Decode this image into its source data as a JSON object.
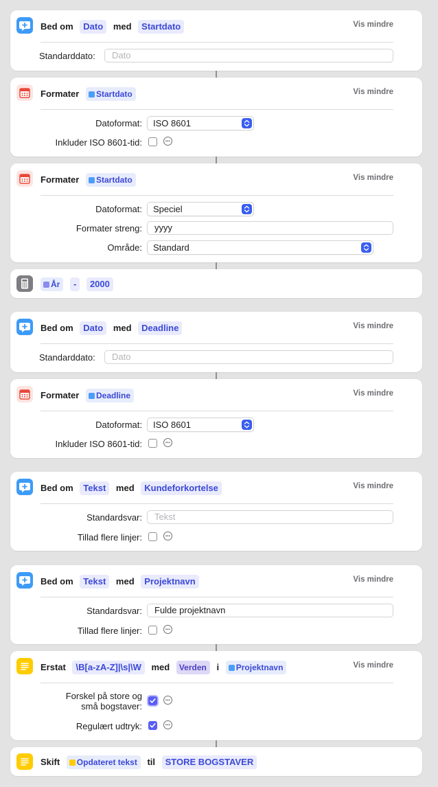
{
  "common": {
    "vis_mindre": "Vis mindre"
  },
  "blocks": {
    "ask_startdato": {
      "verb": "Bed om",
      "type_token": "Dato",
      "med": "med",
      "name_token": "Startdato",
      "default_label": "Standarddato:",
      "default_placeholder": "Dato"
    },
    "format1": {
      "verb": "Formater",
      "input_token": "Startdato",
      "format_label": "Datoformat:",
      "format_value": "ISO 8601",
      "iso_time_label": "Inkluder ISO 8601-tid:"
    },
    "format2": {
      "verb": "Formater",
      "input_token": "Startdato",
      "format_label": "Datoformat:",
      "format_value": "Speciel",
      "string_label": "Formater streng:",
      "string_value": "yyyy",
      "region_label": "Område:",
      "region_value": "Standard"
    },
    "calc": {
      "operand1": "År",
      "operator": "-",
      "operand2": "2000"
    },
    "ask_deadline": {
      "verb": "Bed om",
      "type_token": "Dato",
      "med": "med",
      "name_token": "Deadline",
      "default_label": "Standarddato:",
      "default_placeholder": "Dato"
    },
    "format3": {
      "verb": "Formater",
      "input_token": "Deadline",
      "format_label": "Datoformat:",
      "format_value": "ISO 8601",
      "iso_time_label": "Inkluder ISO 8601-tid:"
    },
    "ask_kunde": {
      "verb": "Bed om",
      "type_token": "Tekst",
      "med": "med",
      "name_token": "Kundeforkortelse",
      "answer_label": "Standardsvar:",
      "answer_placeholder": "Tekst",
      "multiline_label": "Tillad flere linjer:"
    },
    "ask_projekt": {
      "verb": "Bed om",
      "type_token": "Tekst",
      "med": "med",
      "name_token": "Projektnavn",
      "answer_label": "Standardsvar:",
      "answer_value": "Fulde projektnavn",
      "multiline_label": "Tillad flere linjer:"
    },
    "replace": {
      "verb": "Erstat",
      "pattern_token": "\\B[a-zA-Z]|\\s|\\W",
      "med": "med",
      "with_token": "Verden",
      "i": "i",
      "input_token": "Projektnavn",
      "case_label_line1": "Forskel på store og",
      "case_label_line2": "små bogstaver:",
      "regex_label": "Regulært udtryk:"
    },
    "change_case": {
      "verb": "Skift",
      "input_token": "Opdateret tekst",
      "til": "til",
      "case_token": "STORE BOGSTAVER"
    }
  },
  "icons": {
    "ask": "speech-bubble-plus-icon",
    "format": "calendar-icon",
    "calculate": "calculator-icon",
    "text": "text-lines-icon",
    "variable": "variable-icon",
    "checkmark": "checkmark-icon",
    "more": "ellipsis-circle-icon",
    "popup": "chevron-updown-icon"
  },
  "colors": {
    "token_text": "#3b49d6",
    "token_bg": "#e9eafc",
    "ask_icon": "#3d9bf7",
    "calendar_icon": "#e8483a",
    "calc_icon": "#7d7d82",
    "text_icon": "#ffcc00",
    "accent": "#5a5ef5"
  },
  "checks": {
    "format1_iso_time": false,
    "format3_iso_time": false,
    "kunde_multiline": false,
    "projekt_multiline": false,
    "replace_case_sensitive": true,
    "replace_regex": true
  }
}
